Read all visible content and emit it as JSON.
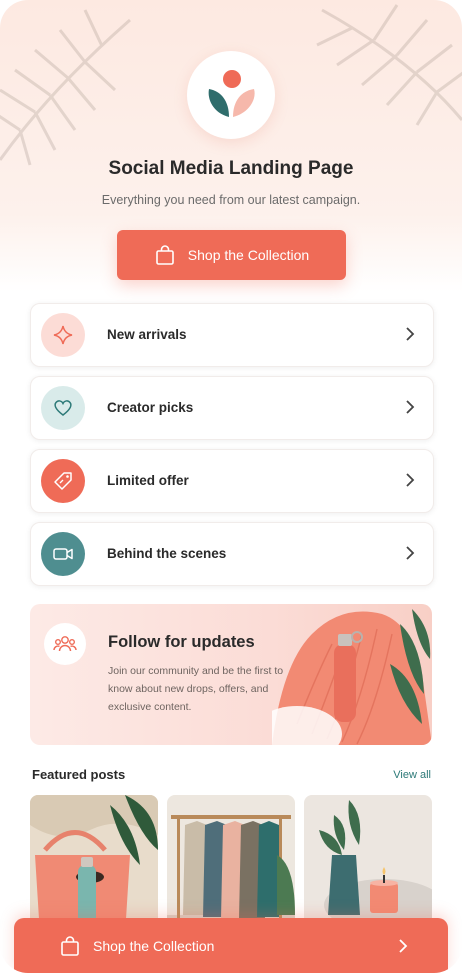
{
  "header": {
    "title": "Social Media Landing Page",
    "subtitle": "Everything you need from our latest campaign."
  },
  "primary_button": {
    "label": "Shop the Collection",
    "icon": "shopping-bag-icon"
  },
  "menu": [
    {
      "label": "New arrivals",
      "icon": "sparkle-icon",
      "bg": "#fcdcd6",
      "icon_color": "#ef6b57"
    },
    {
      "label": "Creator picks",
      "icon": "heart-icon",
      "bg": "#d9ebea",
      "icon_color": "#2d7a78"
    },
    {
      "label": "Limited offer",
      "icon": "tag-icon",
      "bg": "#ef6b57",
      "icon_color": "#ffffff"
    },
    {
      "label": "Behind the scenes",
      "icon": "video-camera-icon",
      "bg": "#4f8e90",
      "icon_color": "#ffffff"
    }
  ],
  "follow": {
    "title": "Follow for updates",
    "text": "Join our community and be the first to know about new drops, offers, and exclusive content.",
    "icon": "community-icon"
  },
  "featured": {
    "title": "Featured posts",
    "view_all": "View all",
    "posts": [
      {
        "name": "tote-bag-post"
      },
      {
        "name": "clothing-rack-post"
      },
      {
        "name": "candle-vase-post"
      }
    ]
  },
  "bottom_bar": {
    "label": "Shop the Collection",
    "icon": "shopping-bag-icon"
  },
  "colors": {
    "accent": "#ef6b57",
    "teal": "#2d7a78",
    "text": "#2a2a2a"
  }
}
